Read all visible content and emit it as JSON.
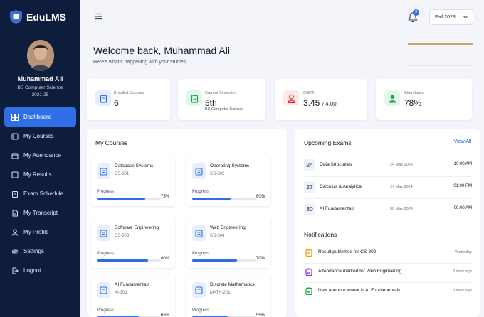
{
  "app": {
    "name": "EduLMS"
  },
  "colors": {
    "sidebar": "#0f1d3d",
    "accent": "#2f6ee6",
    "link": "#2563eb"
  },
  "user": {
    "name": "Muhammad Ali",
    "program": "BS Computer Science",
    "year": "2021-25"
  },
  "nav": {
    "items": [
      {
        "label": "Dashboard",
        "icon": "grid-icon",
        "active": true
      },
      {
        "label": "My Courses",
        "icon": "book-icon"
      },
      {
        "label": "My Attendance",
        "icon": "calendar-icon"
      },
      {
        "label": "My Results",
        "icon": "chart-icon"
      },
      {
        "label": "Exam Schedule",
        "icon": "clipboard-icon"
      },
      {
        "label": "My Transcript",
        "icon": "document-icon"
      },
      {
        "label": "My Profile",
        "icon": "user-icon"
      },
      {
        "label": "Settings",
        "icon": "gear-icon"
      },
      {
        "label": "Logout",
        "icon": "logout-icon"
      }
    ]
  },
  "header": {
    "notification_count": "3",
    "semester": "Fall 2023"
  },
  "welcome": {
    "title": "Welcome back, Muhammad Ali",
    "subtitle": "Here's what's happening with your studies."
  },
  "stats": [
    {
      "label": "Enrolled Courses",
      "value": "6",
      "icon": "clipboard-icon",
      "color": "#2f6ee6"
    },
    {
      "label": "Current Semester",
      "value": "5th",
      "sub": "BS Computer Science",
      "icon": "clipboard-check-icon",
      "color": "#16a34a"
    },
    {
      "label": "CGPA",
      "value": "3.45",
      "suffix": "/ 4.00",
      "icon": "user-icon",
      "color": "#dc2626"
    },
    {
      "label": "Attendance",
      "value": "78%",
      "icon": "user-icon",
      "color": "#16a34a"
    }
  ],
  "courses": {
    "title": "My Courses",
    "progress_label": "Progress",
    "items": [
      {
        "name": "Database Systems",
        "code": "CS-301",
        "progress": 75,
        "progress_text": "75%"
      },
      {
        "name": "Operating Systems",
        "code": "CS-302",
        "progress": 60,
        "progress_text": "60%"
      },
      {
        "name": "Software Engineering",
        "code": "CS-303",
        "progress": 80,
        "progress_text": "80%"
      },
      {
        "name": "Web Engineering",
        "code": "CS-304",
        "progress": 70,
        "progress_text": "70%"
      },
      {
        "name": "AI Fundamentals",
        "code": "AI-301",
        "progress": 65,
        "progress_text": "65%"
      },
      {
        "name": "Discrete Mathematics",
        "code": "MATH-201",
        "progress": 55,
        "progress_text": "55%"
      }
    ]
  },
  "exams": {
    "title": "Upcoming Exams",
    "view_all": "View All",
    "items": [
      {
        "day": "24",
        "name": "Data Structures",
        "date": "24 May 2024",
        "time": "10:00 AM"
      },
      {
        "day": "27",
        "name": "Calculus & Analytical",
        "date": "27 May 2024",
        "time": "01:00 PM"
      },
      {
        "day": "30",
        "name": "AI Fundamentals",
        "date": "30 May 2024",
        "time": "09:00 AM"
      }
    ]
  },
  "notifications": {
    "title": "Notifications",
    "items": [
      {
        "text": "Result published for CS-302",
        "time": "Yesterday",
        "color": "#f59e0b"
      },
      {
        "text": "Attendance marked for Web Engineering",
        "time": "2 days ago",
        "color": "#7c3aed"
      },
      {
        "text": "New announcement in AI Fundamentals",
        "time": "3 days ago",
        "color": "#16a34a"
      }
    ]
  }
}
